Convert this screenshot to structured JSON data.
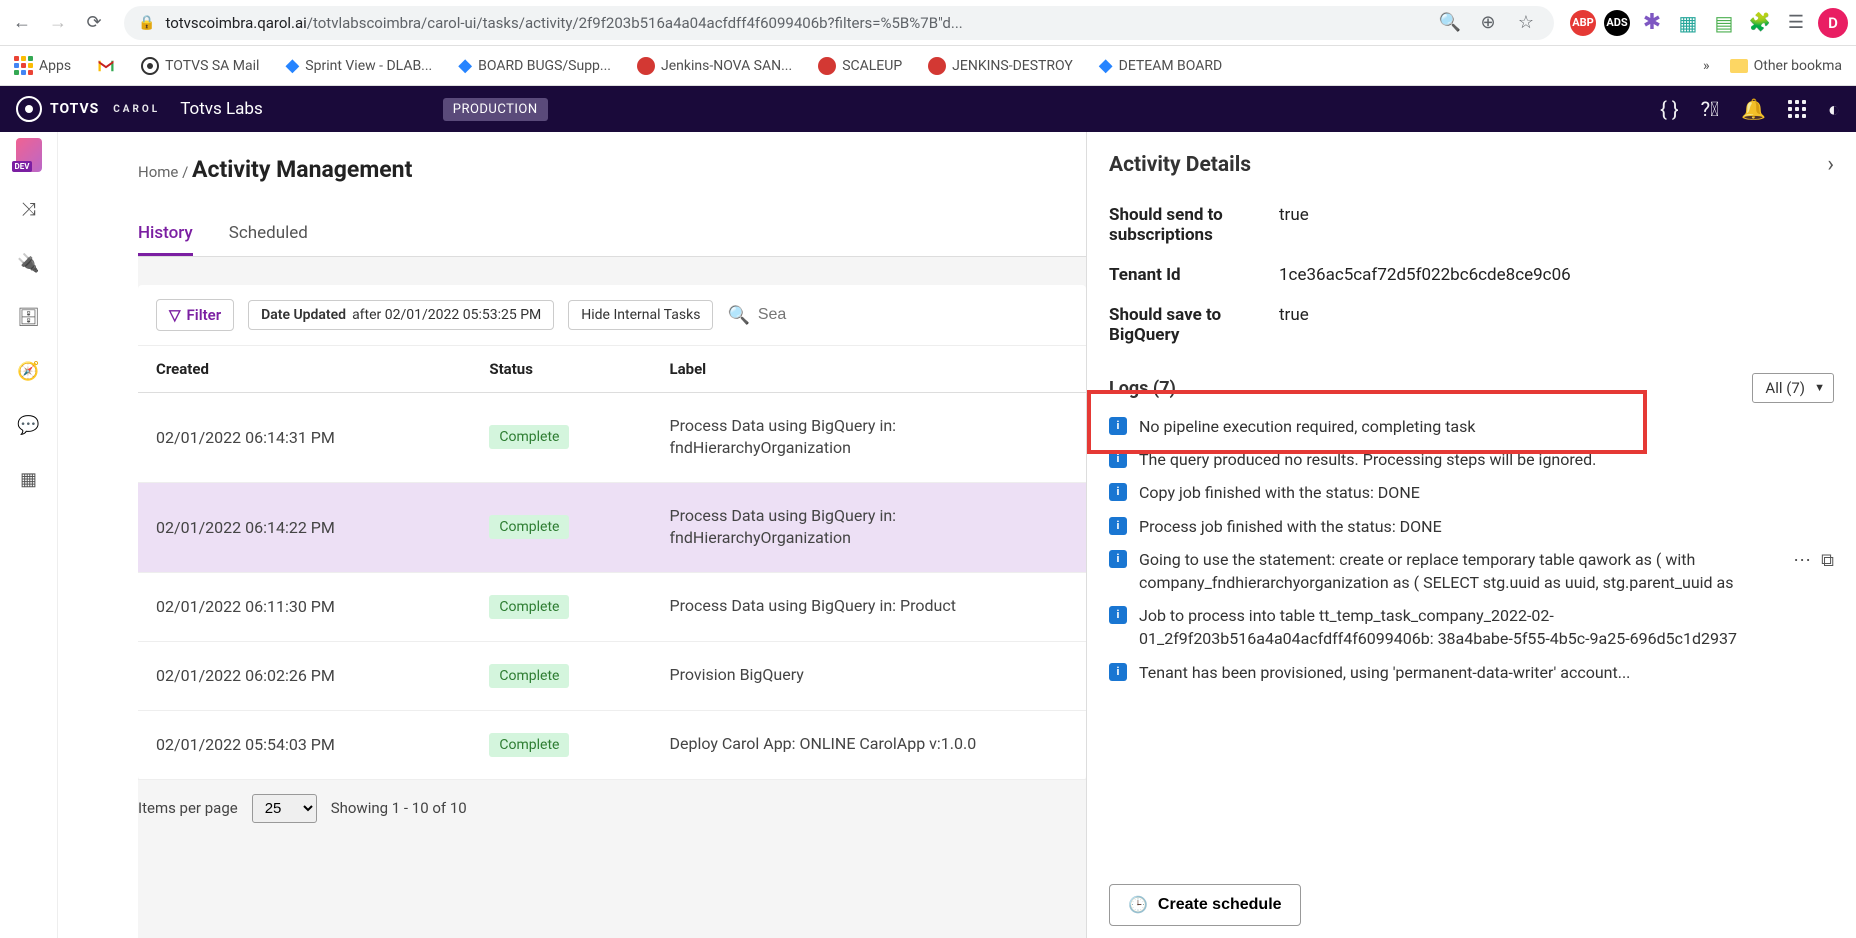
{
  "browser": {
    "url_domain": "totvscoimbra.qarol.ai",
    "url_path": "/totvlabscoimbra/carol-ui/tasks/activity/2f9f203b516a4a04acfdff4f6099406b?filters=%5B%7B\"d...",
    "avatar_letter": "D",
    "ext_abp": "ABP",
    "ext_ads": "ADS"
  },
  "bookmarks": {
    "apps": "Apps",
    "totvs_mail": "TOTVS SA Mail",
    "sprint": "Sprint View - DLAB...",
    "board_bugs": "BOARD BUGS/Supp...",
    "jenkins_nova": "Jenkins-NOVA SAN...",
    "scaleup": "SCALEUP",
    "jenkins_destroy": "JENKINS-DESTROY",
    "deteam": "DETEAM BOARD",
    "more": "»",
    "other": "Other bookma"
  },
  "app_header": {
    "brand": "TOTVS",
    "carol": "CAROL",
    "org": "Totvs Labs",
    "env": "PRODUCTION"
  },
  "breadcrumb": {
    "home": "Home",
    "sep": " / "
  },
  "page_title": "Activity Management",
  "tabs": {
    "history": "History",
    "scheduled": "Scheduled"
  },
  "filter_bar": {
    "filter": "Filter",
    "chip_label": "Date Updated",
    "chip_value": "after 02/01/2022 05:53:25 PM",
    "hide": "Hide Internal Tasks",
    "search_placeholder": "Sea"
  },
  "columns": {
    "created": "Created",
    "status": "Status",
    "label": "Label"
  },
  "rows": [
    {
      "created": "02/01/2022 06:14:31 PM",
      "status": "Complete",
      "label": "Process Data using BigQuery in: fndHierarchyOrganization"
    },
    {
      "created": "02/01/2022 06:14:22 PM",
      "status": "Complete",
      "label": "Process Data using BigQuery in: fndHierarchyOrganization",
      "selected": true
    },
    {
      "created": "02/01/2022 06:11:30 PM",
      "status": "Complete",
      "label": "Process Data using BigQuery in: Product"
    },
    {
      "created": "02/01/2022 06:02:26 PM",
      "status": "Complete",
      "label": "Provision BigQuery"
    },
    {
      "created": "02/01/2022 05:54:03 PM",
      "status": "Complete",
      "label": "Deploy Carol App: ONLINE CarolApp v:1.0.0"
    }
  ],
  "pagination": {
    "items_label": "Items per page",
    "size": "25",
    "showing": "Showing 1 - 10 of 10"
  },
  "details": {
    "title": "Activity Details",
    "fields": [
      {
        "label": "Should send to subscriptions",
        "value": "true"
      },
      {
        "label": "Tenant Id",
        "value": "1ce36ac5caf72d5f022bc6cde8ce9c06"
      },
      {
        "label": "Should save to BigQuery",
        "value": "true"
      }
    ],
    "logs_title": "Logs (7)",
    "logs_filter": "All (7)",
    "logs": [
      "No pipeline execution required, completing task",
      "The query produced no results. Processing steps will be ignored.",
      "Copy job finished with the status: DONE",
      "Process job finished with the status: DONE",
      "Going to use the statement: create or replace temporary table qawork as ( with company_fndhierarchyorganization as ( SELECT stg.uuid as uuid, stg.parent_uuid as",
      "Job to process into table tt_temp_task_company_2022-02-01_2f9f203b516a4a04acfdff4f6099406b: 38a4babe-5f55-4b5c-9a25-696d5c1d2937",
      "Tenant has been provisioned, using 'permanent-data-writer' account..."
    ],
    "create_schedule": "Create schedule"
  }
}
